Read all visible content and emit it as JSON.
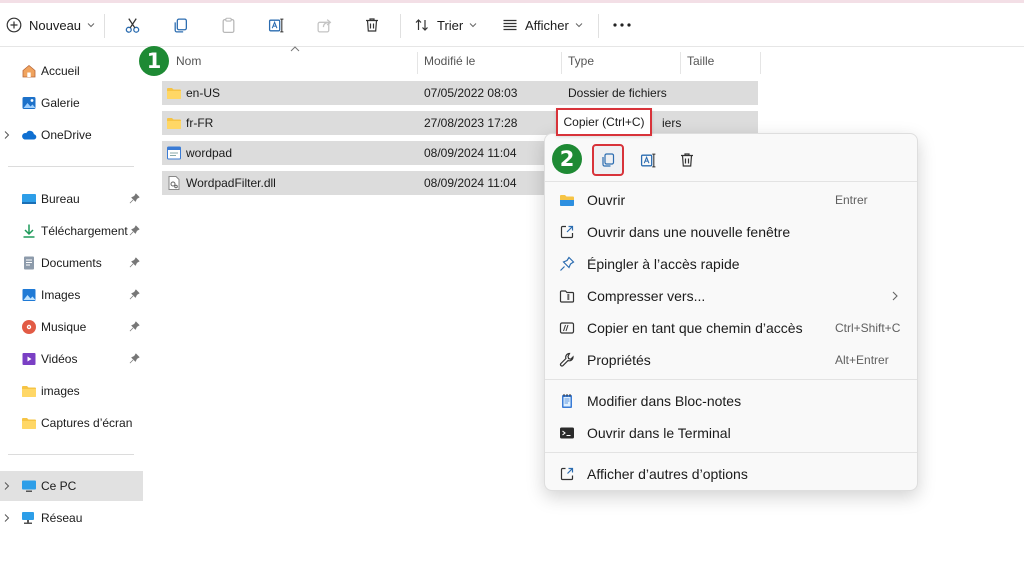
{
  "toolbar": {
    "new_label": "Nouveau",
    "sort_label": "Trier",
    "view_label": "Afficher"
  },
  "sidebar": {
    "items": [
      {
        "label": "Accueil",
        "icon": "home-icon"
      },
      {
        "label": "Galerie",
        "icon": "gallery-icon"
      },
      {
        "label": "OneDrive",
        "icon": "onedrive-cloud-icon"
      },
      {
        "label": "Bureau",
        "icon": "desktop-icon"
      },
      {
        "label": "Téléchargement",
        "icon": "download-icon"
      },
      {
        "label": "Documents",
        "icon": "documents-icon"
      },
      {
        "label": "Images",
        "icon": "pictures-icon"
      },
      {
        "label": "Musique",
        "icon": "music-icon"
      },
      {
        "label": "Vidéos",
        "icon": "videos-icon"
      },
      {
        "label": "images",
        "icon": "folder-icon"
      },
      {
        "label": "Captures d’écran",
        "icon": "folder-icon"
      },
      {
        "label": "Ce PC",
        "icon": "this-pc-icon"
      },
      {
        "label": "Réseau",
        "icon": "network-icon"
      }
    ]
  },
  "columns": {
    "name": "Nom",
    "modified": "Modifié le",
    "type": "Type",
    "size": "Taille"
  },
  "files": [
    {
      "name": "en-US",
      "modified": "07/05/2022 08:03",
      "type": "Dossier de fichiers",
      "icon": "folder-icon"
    },
    {
      "name": "fr-FR",
      "modified": "27/08/2023 17:28",
      "type": "iers",
      "icon": "folder-icon"
    },
    {
      "name": "wordpad",
      "modified": "08/09/2024 11:04",
      "type": "",
      "icon": "application-icon"
    },
    {
      "name": "WordpadFilter.dll",
      "modified": "08/09/2024 11:04",
      "type": "",
      "icon": "dll-file-icon"
    }
  ],
  "badges": {
    "step1": "1",
    "step2": "2"
  },
  "tooltip": "Copier (Ctrl+C)",
  "context_menu": {
    "items": [
      {
        "label": "Ouvrir",
        "shortcut": "Entrer",
        "icon": "folder-open-icon"
      },
      {
        "label": "Ouvrir dans une nouvelle fenêtre",
        "shortcut": "",
        "icon": "open-new-window-icon"
      },
      {
        "label": "Épingler à l’accès rapide",
        "shortcut": "",
        "icon": "pin-icon"
      },
      {
        "label": "Compresser vers...",
        "shortcut": "",
        "icon": "compress-icon"
      },
      {
        "label": "Copier en tant que chemin d’accès",
        "shortcut": "Ctrl+Shift+C",
        "icon": "copy-path-icon"
      },
      {
        "label": "Propriétés",
        "shortcut": "Alt+Entrer",
        "icon": "wrench-icon"
      },
      {
        "label": "Modifier dans Bloc-notes",
        "shortcut": "",
        "icon": "notepad-icon"
      },
      {
        "label": "Ouvrir dans le Terminal",
        "shortcut": "",
        "icon": "terminal-icon"
      },
      {
        "label": "Afficher d’autres d’options",
        "shortcut": "",
        "icon": "more-options-icon"
      }
    ]
  },
  "colors": {
    "badge_green": "#1e8a34",
    "highlight_red": "#d8333a",
    "selection_gray": "#dcdcdc"
  }
}
